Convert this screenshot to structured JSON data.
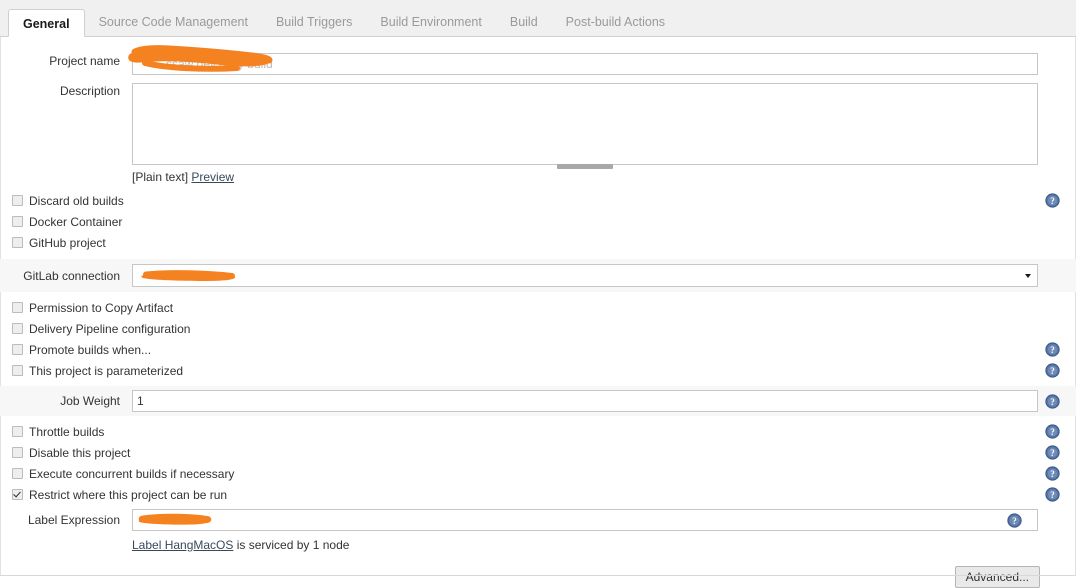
{
  "tabs": [
    {
      "label": "General",
      "active": true
    },
    {
      "label": "Source Code Management",
      "active": false
    },
    {
      "label": "Build Triggers",
      "active": false
    },
    {
      "label": "Build Environment",
      "active": false
    },
    {
      "label": "Build",
      "active": false
    },
    {
      "label": "Post-build Actions",
      "active": false
    }
  ],
  "fields": {
    "project_name_label": "Project name",
    "project_name_value": "",
    "project_name_ghost": "ssaw dev daily build",
    "description_label": "Description",
    "description_value": "",
    "plain_text_label": "[Plain text]",
    "preview_link": "Preview",
    "gitlab_connection_label": "GitLab connection",
    "gitlab_connection_value": "",
    "job_weight_label": "Job Weight",
    "job_weight_value": "1",
    "label_expression_label": "Label Expression",
    "label_expression_value": "",
    "label_node_link": "Label HangMacOS",
    "label_node_suffix": " is serviced by 1 node"
  },
  "checkboxes": [
    {
      "label": "Discard old builds",
      "checked": false,
      "help": true
    },
    {
      "label": "Docker Container",
      "checked": false,
      "help": false
    },
    {
      "label": "GitHub project",
      "checked": false,
      "help": false
    },
    {
      "label": "Permission to Copy Artifact",
      "checked": false,
      "help": false
    },
    {
      "label": "Delivery Pipeline configuration",
      "checked": false,
      "help": false
    },
    {
      "label": "Promote builds when...",
      "checked": false,
      "help": true
    },
    {
      "label": "This project is parameterized",
      "checked": false,
      "help": true
    },
    {
      "label": "Throttle builds",
      "checked": false,
      "help": true
    },
    {
      "label": "Disable this project",
      "checked": false,
      "help": true
    },
    {
      "label": "Execute concurrent builds if necessary",
      "checked": false,
      "help": true
    },
    {
      "label": "Restrict where this project can be run",
      "checked": true,
      "help": true
    }
  ],
  "buttons": {
    "advanced": "Advanced..."
  },
  "icons": {
    "help": "help-icon",
    "dropdown": "chevron-down-icon"
  },
  "colors": {
    "redaction": "#f58220",
    "help_blue": "#3b5a87",
    "link": "#39495c",
    "tab_active_text": "#1a1a1a",
    "tab_inactive_text": "#9a9a9a",
    "row_shade": "#f7f7f7"
  }
}
